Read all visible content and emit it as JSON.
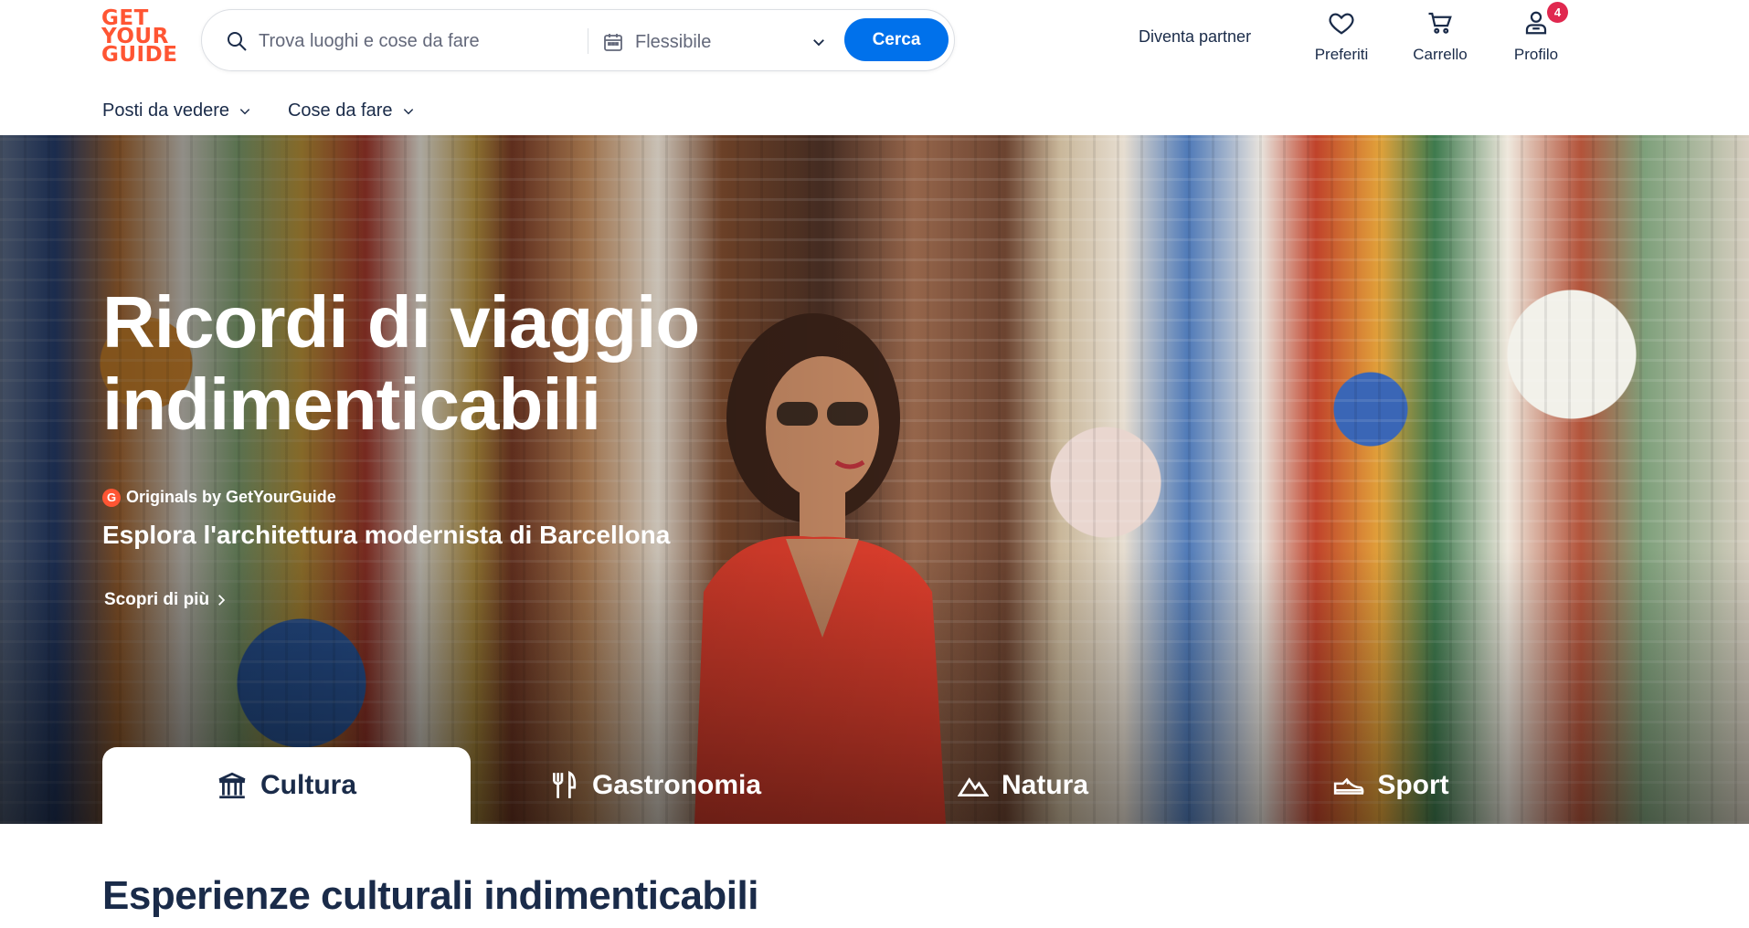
{
  "brand": {
    "logo_lines": [
      "GET",
      "YOUR",
      "GUIDE"
    ],
    "color": "#ff5533"
  },
  "search": {
    "placeholder": "Trova luoghi e cose da fare",
    "date_label": "Flessibile",
    "button_label": "Cerca",
    "button_color": "#0071eb"
  },
  "header": {
    "partner_label": "Diventa partner",
    "favorites_label": "Preferiti",
    "cart_label": "Carrello",
    "profile_label": "Profilo",
    "profile_badge": "4"
  },
  "subnav": {
    "items": [
      {
        "label": "Posti da vedere"
      },
      {
        "label": "Cose da fare"
      }
    ]
  },
  "hero": {
    "title_line1": "Ricordi di viaggio",
    "title_line2": "indimenticabili",
    "originals_icon": "G",
    "originals_label": "Originals by GetYourGuide",
    "subtitle": "Esplora l'architettura modernista di Barcellona",
    "link_label": "Scopri di più"
  },
  "tabs": [
    {
      "label": "Cultura",
      "icon": "museum-icon",
      "active": true
    },
    {
      "label": "Gastronomia",
      "icon": "fork-knife-icon",
      "active": false
    },
    {
      "label": "Natura",
      "icon": "mountain-icon",
      "active": false
    },
    {
      "label": "Sport",
      "icon": "sneaker-icon",
      "active": false
    }
  ],
  "section": {
    "title": "Esperienze culturali indimenticabili"
  },
  "colors": {
    "text_primary": "#1a2b49",
    "badge": "#e0284f"
  }
}
